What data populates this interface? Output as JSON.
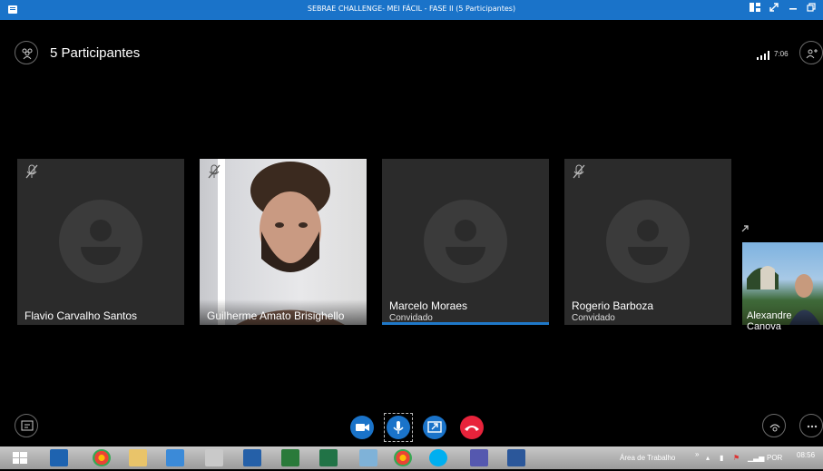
{
  "window": {
    "title": "SEBRAE CHALLENGE- MEI FÁCIL - FASE II (5 Participantes)"
  },
  "header": {
    "participants_label": "5 Participantes",
    "time": "7:06"
  },
  "tiles": [
    {
      "name": "Flavio Carvalho Santos",
      "role": "",
      "muted": true
    },
    {
      "name": "Guilherme Amato Brisighello",
      "role": "",
      "muted": true
    },
    {
      "name": "Marcelo Moraes",
      "role": "Convidado",
      "muted": false
    },
    {
      "name": "Rogerio Barboza",
      "role": "Convidado",
      "muted": true
    },
    {
      "name": "Alexandre Canova",
      "role": "",
      "muted": false
    }
  ],
  "controls": {
    "video": "video-icon",
    "mic": "microphone-icon",
    "share": "share-screen-icon",
    "hangup": "hang-up-icon"
  },
  "taskbar": {
    "area_label": "Área de Trabalho",
    "language": "POR",
    "clock": "08:56"
  },
  "colors": {
    "accent": "#1a73c9",
    "hangup": "#e8233b",
    "tile": "#2b2b2b"
  }
}
